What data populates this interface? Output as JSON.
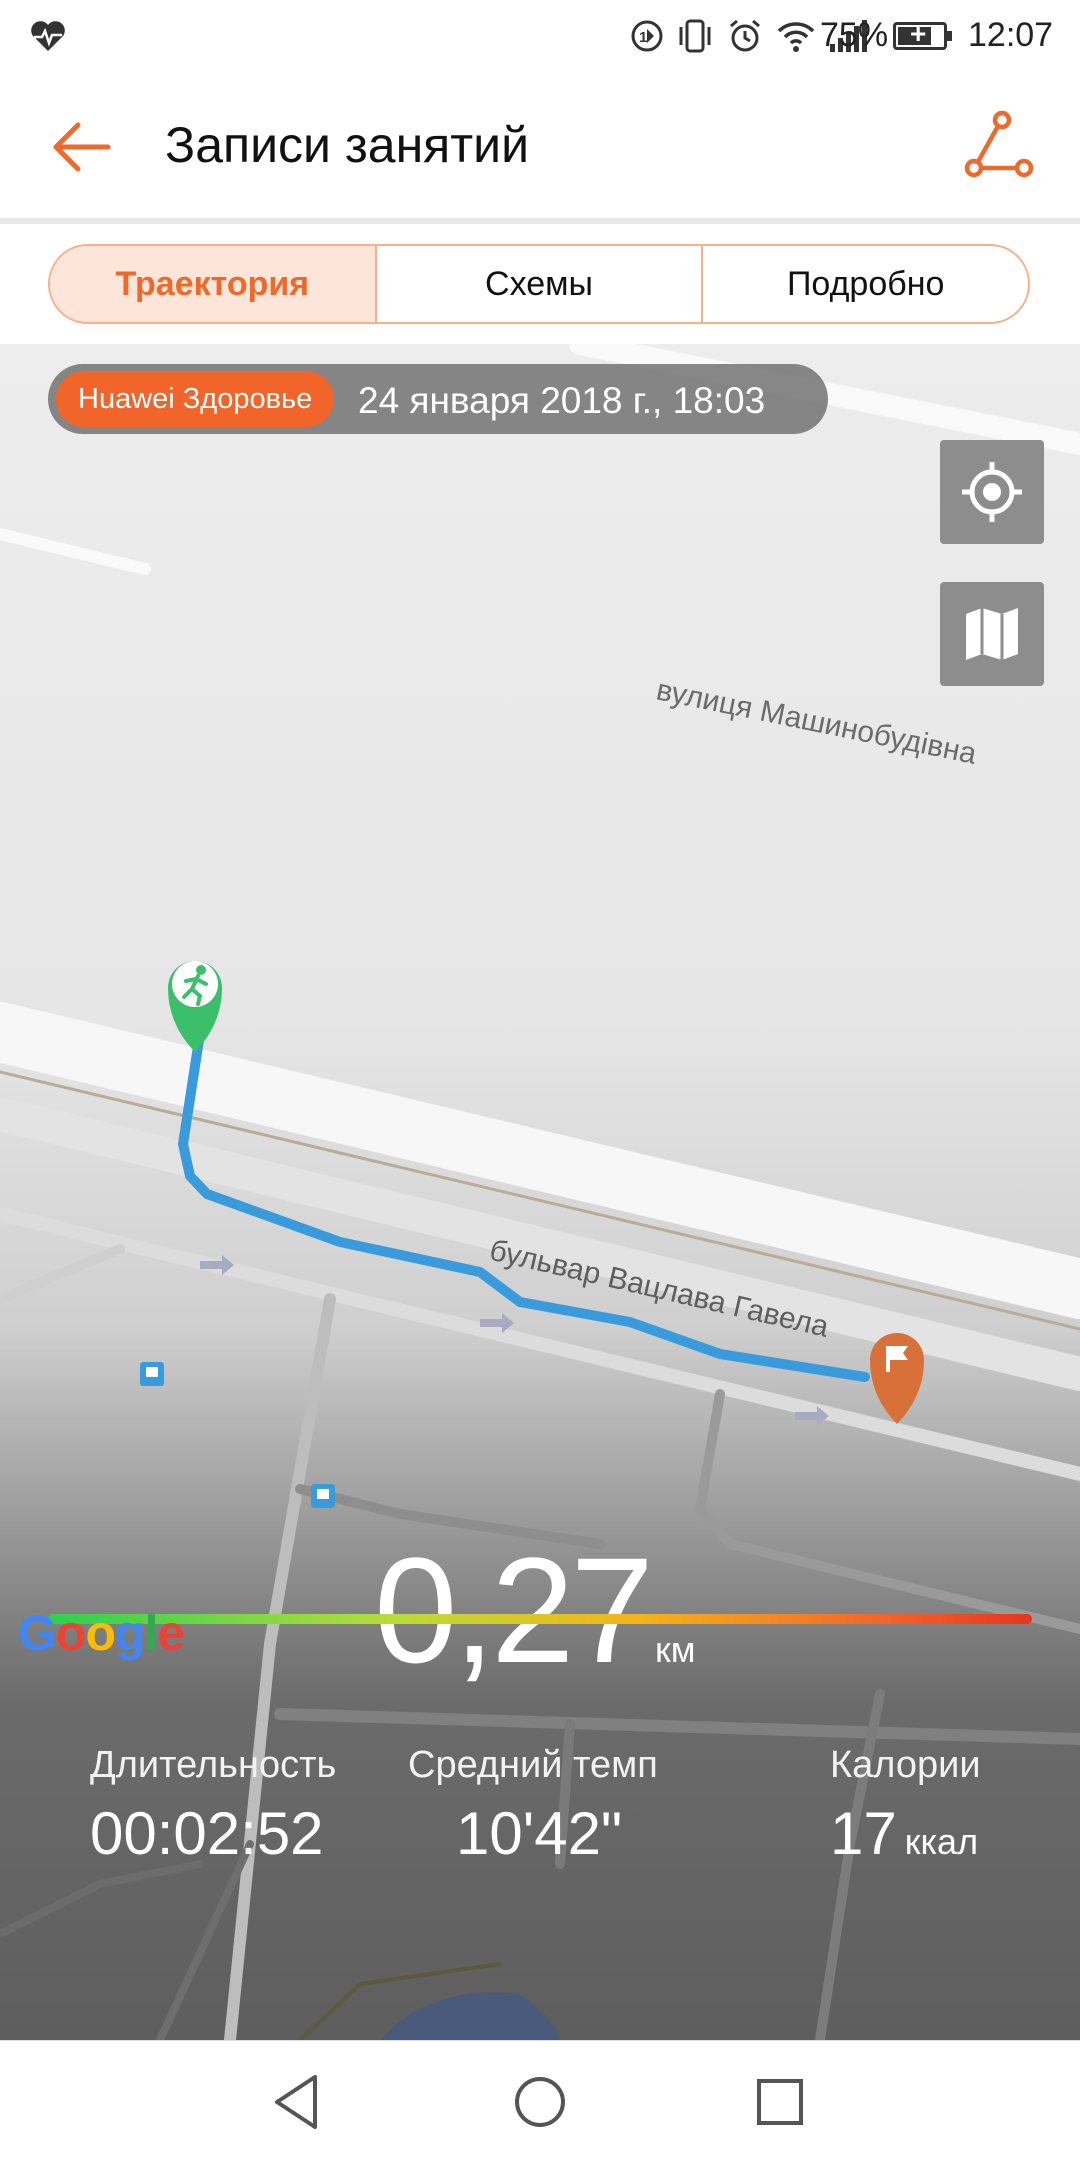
{
  "status_bar": {
    "battery_percent": "75%",
    "battery_level": 0.75,
    "time": "12:07",
    "icons": [
      "health-heart-icon",
      "data-saver-icon",
      "vibrate-icon",
      "alarm-icon",
      "wifi-icon",
      "cellular-signal-icon",
      "battery-charging-icon"
    ]
  },
  "app_bar": {
    "title": "Записи занятий",
    "back_icon": "arrow-left-icon",
    "route_icon": "route-share-icon",
    "accent_color": "#ee6a2c"
  },
  "tabs": [
    {
      "label": "Траектория",
      "active": true
    },
    {
      "label": "Схемы",
      "active": false
    },
    {
      "label": "Подробно",
      "active": false
    }
  ],
  "map": {
    "source_badge": "Huawei Здоровье",
    "date": "24 января 2018 г., 18:03",
    "street_labels": [
      "вулиця Машинобудівна",
      "бульвар Вацлава Гавела"
    ],
    "route_color": "#3a9bdc",
    "start_marker": "runner-start-icon",
    "end_marker": "finish-flag-icon",
    "google_logo": "Google"
  },
  "stats": {
    "distance": "0,27",
    "distance_unit": "км",
    "duration_label": "Длительность",
    "duration_value": "00:02:52",
    "pace_label": "Средний темп",
    "pace_value": "10'42\"",
    "calories_label": "Калории",
    "calories_value": "17",
    "calories_unit": "ккал"
  },
  "nav_bar": {
    "icons": [
      "nav-back-icon",
      "nav-home-icon",
      "nav-recent-icon"
    ]
  }
}
